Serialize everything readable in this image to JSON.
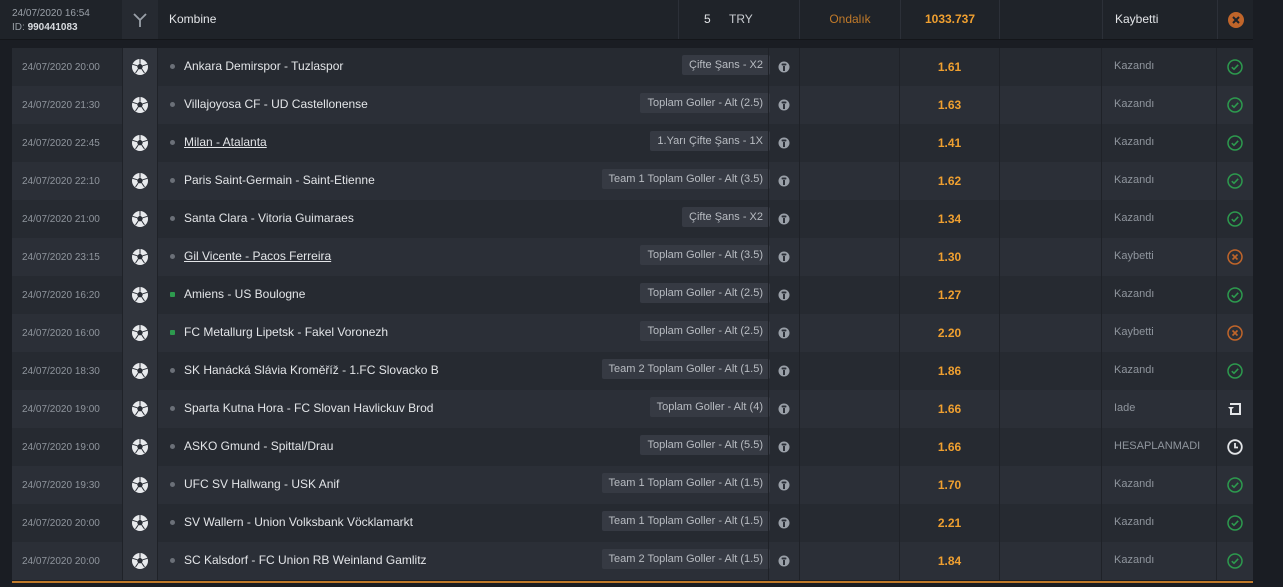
{
  "header": {
    "datetime": "24/07/2020 16:54",
    "id_label": "ID:",
    "id_value": "990441083",
    "bet_type": "Kombine",
    "stake": "5",
    "currency": "TRY",
    "odds_format": "Ondalık",
    "total_odds": "1033.737",
    "status": "Kaybetti",
    "result_icon": "lost-x-icon"
  },
  "colors": {
    "accent": "#f0a030",
    "won": "#2d9a4e",
    "lost": "#c0652a"
  },
  "rows": [
    {
      "date": "24/07/2020 20:00",
      "match": "Ankara Demirspor - Tuzlaspor",
      "market": "Çifte Şans - X2",
      "odds": "1.61",
      "status": "Kazandı",
      "result": "won",
      "underline": false,
      "dot": "gray"
    },
    {
      "date": "24/07/2020 21:30",
      "match": "Villajoyosa CF - UD Castellonense",
      "market": "Toplam Goller - Alt (2.5)",
      "odds": "1.63",
      "status": "Kazandı",
      "result": "won",
      "underline": false,
      "dot": "gray"
    },
    {
      "date": "24/07/2020 22:45",
      "match": "Milan - Atalanta",
      "market": "1.Yarı Çifte Şans - 1X",
      "odds": "1.41",
      "status": "Kazandı",
      "result": "won",
      "underline": true,
      "dot": "gray"
    },
    {
      "date": "24/07/2020 22:10",
      "match": "Paris Saint-Germain - Saint-Etienne",
      "market": "Team 1 Toplam Goller - Alt (3.5)",
      "odds": "1.62",
      "status": "Kazandı",
      "result": "won",
      "underline": false,
      "dot": "gray"
    },
    {
      "date": "24/07/2020 21:00",
      "match": "Santa Clara - Vitoria Guimaraes",
      "market": "Çifte Şans - X2",
      "odds": "1.34",
      "status": "Kazandı",
      "result": "won",
      "underline": false,
      "dot": "gray"
    },
    {
      "date": "24/07/2020 23:15",
      "match": "Gil Vicente - Pacos Ferreira",
      "market": "Toplam Goller - Alt (3.5)",
      "odds": "1.30",
      "status": "Kaybetti",
      "result": "lost",
      "underline": true,
      "dot": "gray"
    },
    {
      "date": "24/07/2020 16:20",
      "match": "Amiens - US Boulogne",
      "market": "Toplam Goller - Alt (2.5)",
      "odds": "1.27",
      "status": "Kazandı",
      "result": "won",
      "underline": false,
      "dot": "green"
    },
    {
      "date": "24/07/2020 16:00",
      "match": "FC Metallurg Lipetsk - Fakel Voronezh",
      "market": "Toplam Goller - Alt (2.5)",
      "odds": "2.20",
      "status": "Kaybetti",
      "result": "lost",
      "underline": false,
      "dot": "green"
    },
    {
      "date": "24/07/2020 18:30",
      "match": "SK Hanácká Slávia Kroměříž - 1.FC Slovacko B",
      "market": "Team 2 Toplam Goller - Alt (1.5)",
      "odds": "1.86",
      "status": "Kazandı",
      "result": "won",
      "underline": false,
      "dot": "gray"
    },
    {
      "date": "24/07/2020 19:00",
      "match": "Sparta Kutna Hora - FC Slovan Havlickuv Brod",
      "market": "Toplam Goller - Alt (4)",
      "odds": "1.66",
      "status": "Iade",
      "result": "refund",
      "underline": false,
      "dot": "gray"
    },
    {
      "date": "24/07/2020 19:00",
      "match": "ASKO Gmund - Spittal/Drau",
      "market": "Toplam Goller - Alt (5.5)",
      "odds": "1.66",
      "status": "HESAPLANMADI",
      "result": "pending",
      "underline": false,
      "dot": "gray"
    },
    {
      "date": "24/07/2020 19:30",
      "match": "UFC SV Hallwang - USK Anif",
      "market": "Team 1 Toplam Goller - Alt (1.5)",
      "odds": "1.70",
      "status": "Kazandı",
      "result": "won",
      "underline": false,
      "dot": "gray"
    },
    {
      "date": "24/07/2020 20:00",
      "match": "SV Wallern - Union Volksbank Vöcklamarkt",
      "market": "Team 1 Toplam Goller - Alt (1.5)",
      "odds": "2.21",
      "status": "Kazandı",
      "result": "won",
      "underline": false,
      "dot": "gray"
    },
    {
      "date": "24/07/2020 20:00",
      "match": "SC Kalsdorf - FC Union RB Weinland Gamlitz",
      "market": "Team 2 Toplam Goller - Alt (1.5)",
      "odds": "1.84",
      "status": "Kazandı",
      "result": "won",
      "underline": false,
      "dot": "gray"
    }
  ]
}
